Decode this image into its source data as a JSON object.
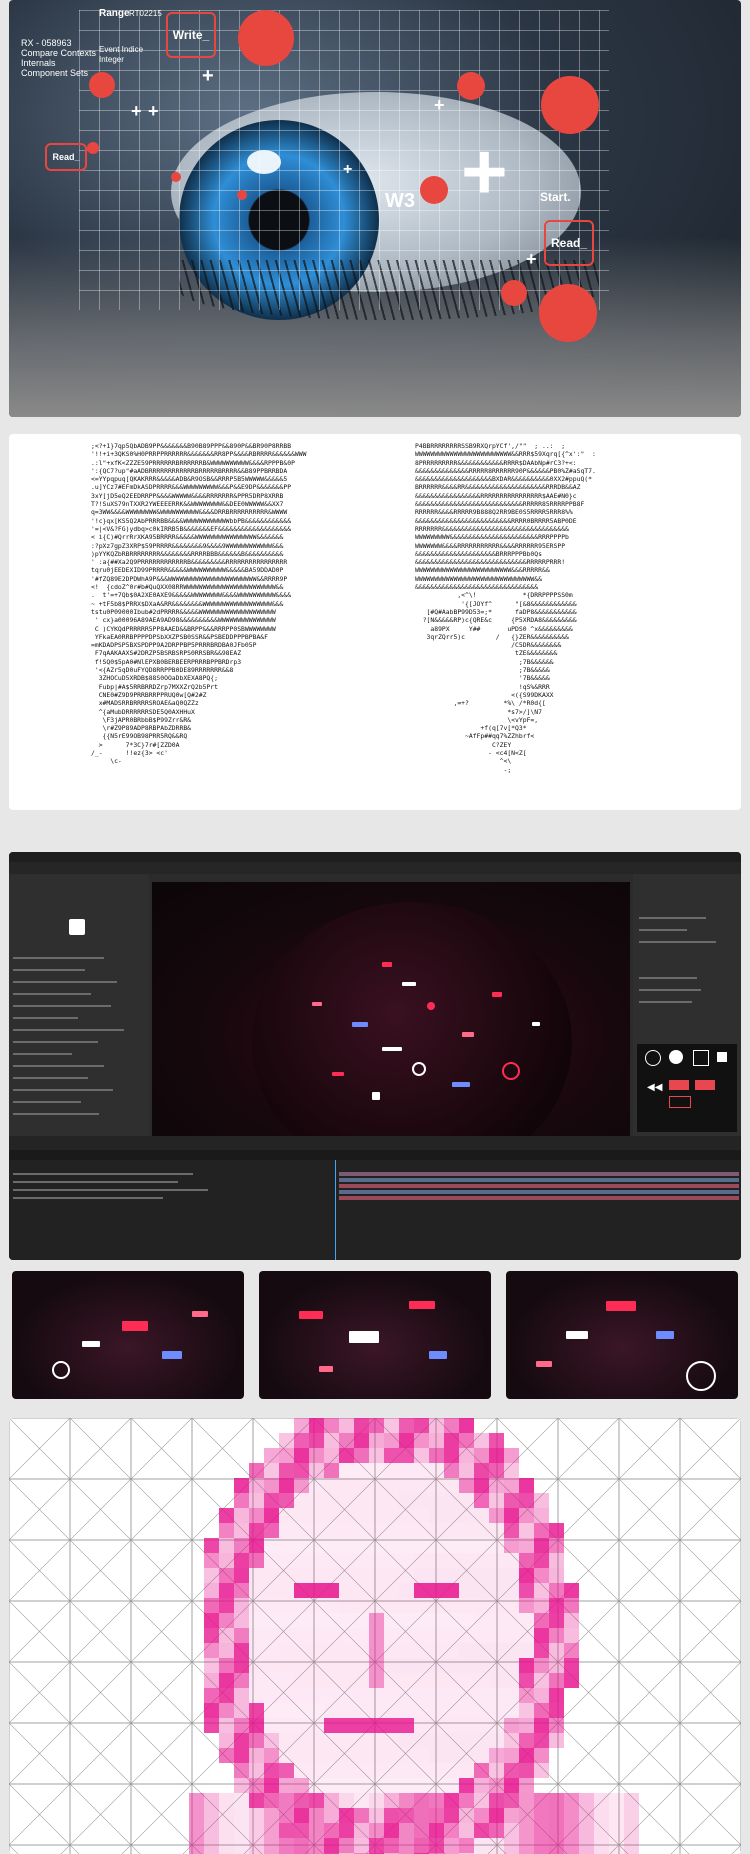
{
  "eye_panel": {
    "top_left_codes": [
      "RX - 058963",
      "Compare Contexts",
      "Internals",
      "Component Sets"
    ],
    "range_label": "Range",
    "range_value": "RT02215",
    "event_indice": "Event Indice",
    "integer": "Integer",
    "write_button": "Write_",
    "read_button_left": "Read_",
    "read_button_right": "Read_",
    "start_label": "Start.",
    "w3_label": "W3",
    "accent_color": "#e8473f"
  },
  "ascii_panel": {
    "left_block": ";<?+1}7qp5QbADB9PP&&&&&&&B90B89PPP&&890P&&BR90P8RRBB\n'!!+i+3QKS0%H0PRRPPRRRRRR&&&&&&&RR8PP&&&&RBRRRR&&&&&&WWW\n.:l\"+xfK<ZZZE59PRRRRRRBRRRRRRB&WWWWWWWWWW&&&&RPPPB&0P\n':{QC7?up\"#aADBRRRRRRRRRRRRBRRRRRBRRRR&&B89PPBRRBDA\n<=YYpqpuq[QKAKRRR&&&&&ADB&R9OSB&&RRRP5B5WWWWW&&&&&5\n.u]YCz7#EFmDkASDPRRRR&&&WWWWWWWWW&&&P&&E9DP&&&&&&&PP\n3xY[jD5eQ2EEDRRPP&&&&WWWWW&&&&RRRRRRR&PPR5DRP8XRRB\nT?!SuXS79nTXXR2YWEEEERRK&&WWWWWWWW&&DEE0WWWWW&&XX7\nq=3WW&&&&WWWWWWWW&WWWWWWWWWW&&&&DRRBRRRRRRRRRR&WWWW\n'!c}qx[KS5Q2AbPRRRBB&&&&WWWWWWWWWWWWbbPB&&&&&&&&&&&&\n'=|<V&?FG)ydbq>c0kIRRB5B&&&&&&&EF&&&&&&&&&&&&&&&&&&&\n< i{C)#QrrRrXKA95BRRRR&&&&&WWWWWWWWWWWWWWWW&&&&&&&\n:?pXz7gpZ3XRP$59PRRRR&&&&&&&&9&&&&9WWWWWWWWWWWW&&&\n)pYYKQZbRBRRRRRRRR&&&&&&&&RRRRBBB&&&&&&B&&&&&&&&&&\n' :a{##Xa2Q9PRRRRRRRRRRRRB&&&&&&&&&RRRRRRRRRRRRRRRR\ntqru0jEEDEXID99PRRRR&&&&&WWWWWWWWWW&&&&&BA59DDAD0P\n'#fZQ89E2DPDWhA9P&&&WWWWWWWWWWWWWWWWWWWWWWW&&RRRR9P\n<!  {cdoZ^0r#b#QuQXX08RRWWWWWWWWWWWWWWWWWWWWWWWW&&\n.  t'=+7Qb$0A2XE0AXE9&&&&&WWWWWWWW&&&&WWWWWWWWWW&&&&\n~ +tF5b8$PRRX$DXaA&RR&&&&&&&&WWWWWWWWWWWWWWWWWW&&&\ntstu0P09000Ibub#2dPRRRR&&&&&WWWWWWWWWWWWWWWWWWWW\n ' cx}a00096A89AEA9AD98&&&&&&&&&&WWWWWWWWWWWWWWW\n C )CYKQdPRRRRR5PP8AAED&&BRPP&&&RRRPP0SBWWWWWWWW\n YFkaEA0RRBPPPPDPSbXXZPSB0SSR&&PSBEDDPPPBPBA&F\n=mKDADPSP5BXSPDPP9A2DRPPBP5PRRRBRDBA0JFb05P\n F7qAAKAAXS#2DRZP5BSRBSRPS0RRSBR&&98EAZ\n f!SQ0$5pA0#NlEPXB0BERBEERPRRRBPPBRDrp3\n '<{AZr5qD0uFYQD8RRPPB0DE89RRRRRRR&&8\n  3ZHOCuD5XRDB$88S0OOaDbXEXA8PQ{;\n  Fubp|#A$5RRBRRDZrp7MXXZrQ2b5Prt\n  CNE0#Z9D9PRRBRRPPRUQ0w[Q#2#Z\n  x#MADSRRBRRRRSROAE&aQ0QZZz\n  ^{aMubDRRRRRRSDE5Q0AXHHuX\n   \\F3jAPR0BRbbB$P99Zrr&R&\n   \\r#Z9P89ADP8RBPAbZDRRB&\n   {{N5rE99OB98PRR5RQ&&RQ\n  >      7*3C}7r#[ZZD0A\n/_-      !!ez{3> <c'\n     \\c-",
    "right_block": "P4BBRRRRRRRRSSB9RXQrpYCf',/\"\"  ; ..:  ;\nWWWWWWWWWWWWWWWWWWWWWWWWW&&RRR$59Xqrq[{^x':\"  :\n8PRRRRRRRRR&&&&&&&&&&&&RRRR$DAAbNp#rC3?+<:\n&&&&&&&&&&&&&&RRRRR8RRRRRR90P&&&&&&PB0%Z#aSqT7.\n&&&&&&&&&&&&&&&&&&&&BXDAR&&&&&&&&&&0XX2#ppuQ(*\nBRRRRRR&&&&RR&&&&&&&&&&&&&&&&&&&&&RRRDB&&AZ\n&&&&&&&&&&&&&&&&&RRRRRRRRRRRRRRRR$AAE#N0}c\n&&&&&&&&&&&&&&&&&&&&&&&&&&&&RRRRR85RRRRPPB8F\nRRRRRR&&&&RRRRR9B888Q2RR9BE0S5RRRR5RRR8%%\n&&&&&&&&&&&&&&&&&&&&&&&&&RRRR0BRRRR5ABP0DE\nRRRRRRR&&&&&&&&&&&&&&&&&&&&&&&&&&&&&&&&&\nWWWWWWWWW&&&&&&&&&&&&&&&&&&&&&&&RRRPPPPb\nWWWWWWW&&&&RRRRRRRRRRR&&&&RRRRRR95ERSPP\n&&&&&&&&&&&&&&&&&&&&&BRRRPPPBb0Qs\n&&&&&&&&&&&&&&&&&&&&&&&&&&&&&RRRRRPRRR!\nWWWWWWWWWWWWWWWWWWWWWWWWW&&&RRRRR&&\nWWWWWWWWWWWWWWWWWWWWWWWWWWWWWWW&&\n&&&&&&&&&&&&&&&&&&&&&&&&&&&&&&&&\n           ,<^\\!            *{DRRPPPPSS0m\n            '{[JOYf^      \"[&8&&&&&&&&&&&&\n   [#Q#AabBP99D53=;*      faDP8&&&&&&&&&&&\n  ?[N&&&&&RP)c{QRE&c     {P5XRDA8&&&&&&&&&\n    a89PX     Y##       uPDS0 ^x&&&&&&&&&\n   3qrZQrr5)c        /   {}ZER&&&&&&&&&&\n                         /C5DR&&&&&&&&\n                          tZE&&&&&&&&\n                           ;7B&&&&&&\n                           ;7B&&&&&\n                           '7B&&&&&\n                           !qS%&RRR\n                         <({S99DKAXX\n          ,=+?         *%\\ /*R0d{[\n                        *s7>/]\\N7\n                        \\<vYpF=,\n                 +f(q[7v[*Q3*\n             ~AfFp##qq7%ZZhbrf<\n                    C?ZEY\n                   - <c4[N<Z[\n                      ^<\\\n                       -;"
  },
  "editor_panel": {
    "viewer_bg": "#16080d",
    "light_colors": [
      "#ff2d55",
      "#ffffff",
      "#6f8cff",
      "#ff6a8a"
    ]
  },
  "thumbnails": [
    {
      "name": "thumb-1"
    },
    {
      "name": "thumb-2"
    },
    {
      "name": "thumb-3"
    }
  ],
  "pixel_portrait": {
    "accent_color": "#e60f8c"
  }
}
